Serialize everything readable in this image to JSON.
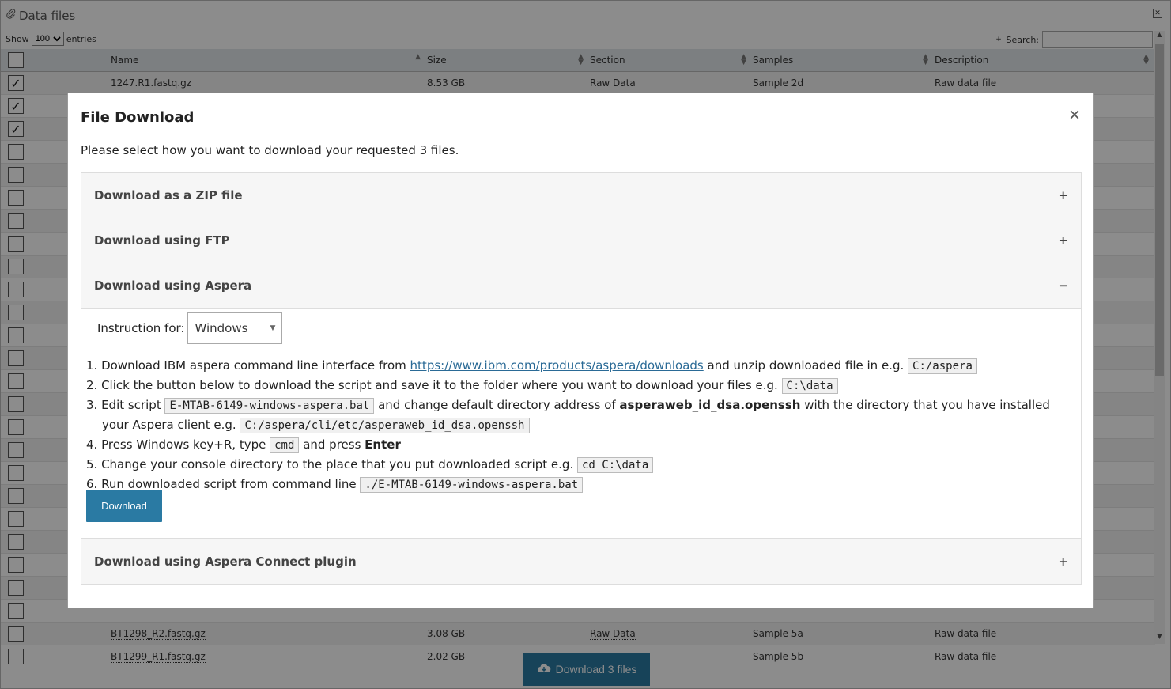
{
  "page": {
    "title": "Data files",
    "show_label": "Show",
    "show_value": "100",
    "entries_label": "entries",
    "search_label": "Search:",
    "columns": [
      "Name",
      "Size",
      "Section",
      "Samples",
      "Description"
    ],
    "rows": [
      {
        "checked": true,
        "name": "1247.R1.fastq.gz",
        "size": "8.53 GB",
        "section": "Raw Data",
        "samples": "Sample 2d",
        "description": "Raw data file"
      },
      {
        "checked": true,
        "name": "",
        "size": "",
        "section": "",
        "samples": "",
        "description": ""
      },
      {
        "checked": true,
        "name": "",
        "size": "",
        "section": "",
        "samples": "",
        "description": ""
      },
      {
        "checked": false,
        "name": "",
        "size": "",
        "section": "",
        "samples": "",
        "description": ""
      },
      {
        "checked": false,
        "name": "",
        "size": "",
        "section": "",
        "samples": "",
        "description": ""
      },
      {
        "checked": false,
        "name": "",
        "size": "",
        "section": "",
        "samples": "",
        "description": ""
      },
      {
        "checked": false,
        "name": "",
        "size": "",
        "section": "",
        "samples": "",
        "description": ""
      },
      {
        "checked": false,
        "name": "",
        "size": "",
        "section": "",
        "samples": "",
        "description": ""
      },
      {
        "checked": false,
        "name": "",
        "size": "",
        "section": "",
        "samples": "",
        "description": ""
      },
      {
        "checked": false,
        "name": "",
        "size": "",
        "section": "",
        "samples": "",
        "description": ""
      },
      {
        "checked": false,
        "name": "",
        "size": "",
        "section": "",
        "samples": "",
        "description": ""
      },
      {
        "checked": false,
        "name": "",
        "size": "",
        "section": "",
        "samples": "",
        "description": ""
      },
      {
        "checked": false,
        "name": "",
        "size": "",
        "section": "",
        "samples": "",
        "description": ""
      },
      {
        "checked": false,
        "name": "",
        "size": "",
        "section": "",
        "samples": "",
        "description": ""
      },
      {
        "checked": false,
        "name": "",
        "size": "",
        "section": "",
        "samples": "",
        "description": ""
      },
      {
        "checked": false,
        "name": "",
        "size": "",
        "section": "",
        "samples": "",
        "description": ""
      },
      {
        "checked": false,
        "name": "",
        "size": "",
        "section": "",
        "samples": "",
        "description": ""
      },
      {
        "checked": false,
        "name": "",
        "size": "",
        "section": "",
        "samples": "",
        "description": ""
      },
      {
        "checked": false,
        "name": "",
        "size": "",
        "section": "",
        "samples": "",
        "description": ""
      },
      {
        "checked": false,
        "name": "",
        "size": "",
        "section": "",
        "samples": "",
        "description": ""
      },
      {
        "checked": false,
        "name": "",
        "size": "",
        "section": "",
        "samples": "",
        "description": ""
      },
      {
        "checked": false,
        "name": "",
        "size": "",
        "section": "",
        "samples": "",
        "description": ""
      },
      {
        "checked": false,
        "name": "",
        "size": "",
        "section": "",
        "samples": "",
        "description": ""
      },
      {
        "checked": false,
        "name": "",
        "size": "",
        "section": "",
        "samples": "",
        "description": ""
      },
      {
        "checked": false,
        "name": "BT1298_R2.fastq.gz",
        "size": "3.08 GB",
        "section": "Raw Data",
        "samples": "Sample 5a",
        "description": "Raw data file"
      },
      {
        "checked": false,
        "name": "BT1299_R1.fastq.gz",
        "size": "2.02 GB",
        "section": "Raw Data",
        "samples": "Sample 5b",
        "description": "Raw data file"
      }
    ],
    "download_files_label": "Download 3 files"
  },
  "modal": {
    "title": "File Download",
    "close_glyph": "×",
    "description": "Please select how you want to download your requested 3 files.",
    "sections": {
      "zip": {
        "label": "Download as a ZIP file",
        "sign": "+"
      },
      "ftp": {
        "label": "Download using FTP",
        "sign": "+"
      },
      "aspera": {
        "label": "Download using Aspera",
        "sign": "−"
      },
      "connect": {
        "label": "Download using Aspera Connect plugin",
        "sign": "+"
      }
    },
    "aspera": {
      "instruction_label": "Instruction for:",
      "os_value": "Windows",
      "steps": {
        "s1_a": "1. Download IBM aspera command line interface from ",
        "s1_link": "https://www.ibm.com/products/aspera/downloads",
        "s1_b": " and unzip downloaded file in e.g. ",
        "s1_code": "C:/aspera",
        "s2_a": "2. Click the button below to download the script and save it to the folder where you want to download your files e.g. ",
        "s2_code": "C:\\data",
        "s3_a": "3. Edit script ",
        "s3_code1": "E-MTAB-6149-windows-aspera.bat",
        "s3_b": " and change default directory address of ",
        "s3_bold": "asperaweb_id_dsa.openssh",
        "s3_c": " with the directory that you have installed your Aspera client e.g. ",
        "s3_code2": "C:/aspera/cli/etc/asperaweb_id_dsa.openssh",
        "s4_a": "4. Press Windows key+R, type ",
        "s4_code": "cmd",
        "s4_b": " and press ",
        "s4_bold": "Enter",
        "s5_a": "5. Change your console directory to the place that you put downloaded script e.g. ",
        "s5_code": "cd C:\\data",
        "s6_a": "6. Run downloaded script from command line ",
        "s6_code": "./E-MTAB-6149-windows-aspera.bat"
      },
      "download_label": "Download"
    }
  }
}
